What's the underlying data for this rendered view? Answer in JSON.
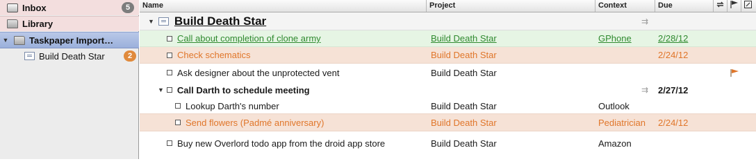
{
  "colors": {
    "sidebar_bg": "#ececec",
    "selected_bg": "#a9bce2",
    "green_row_bg": "#e6f5e4",
    "orange_row_bg": "#f6e2d6",
    "green_text": "#2f8a2f",
    "orange_text": "#e0762a",
    "badge_grey": "#7d7d7d",
    "badge_orange": "#e08a3c"
  },
  "sidebar": {
    "inbox": {
      "label": "Inbox",
      "count": "5",
      "icon": "inbox-tray-icon"
    },
    "library": {
      "label": "Library",
      "icon": "folder-icon"
    },
    "import_folder": {
      "label": "Taskpaper Import…",
      "icon": "folder-icon"
    },
    "project": {
      "label": "Build Death Star",
      "count": "2",
      "icon": "project-icon"
    }
  },
  "columns": {
    "name": "Name",
    "project": "Project",
    "context": "Context",
    "due": "Due",
    "repeat_icon": "repeat-icon",
    "flag_icon": "flag-icon",
    "note_icon": "note-icon"
  },
  "group": {
    "title": "Build Death Star"
  },
  "tasks": [
    {
      "name": "Call about completion of clone army",
      "project": "Build Death Star",
      "context": "GPhone",
      "due": "2/28/12"
    },
    {
      "name": "Check schematics",
      "project": "Build Death Star",
      "context": "",
      "due": "2/24/12"
    },
    {
      "name": "Ask designer about the unprotected vent",
      "project": "Build Death Star",
      "context": "",
      "due": ""
    },
    {
      "name": "Call Darth to schedule meeting",
      "project": "",
      "context": "",
      "due": "2/27/12"
    },
    {
      "name": "Lookup Darth's number",
      "project": "Build Death Star",
      "context": "Outlook",
      "due": ""
    },
    {
      "name": "Send flowers (Padmé anniversary)",
      "project": "Build Death Star",
      "context": "Pediatrician",
      "due": "2/24/12"
    },
    {
      "name": "Buy new Overlord todo app from the droid app store",
      "project": "Build Death Star",
      "context": "Amazon",
      "due": ""
    }
  ]
}
